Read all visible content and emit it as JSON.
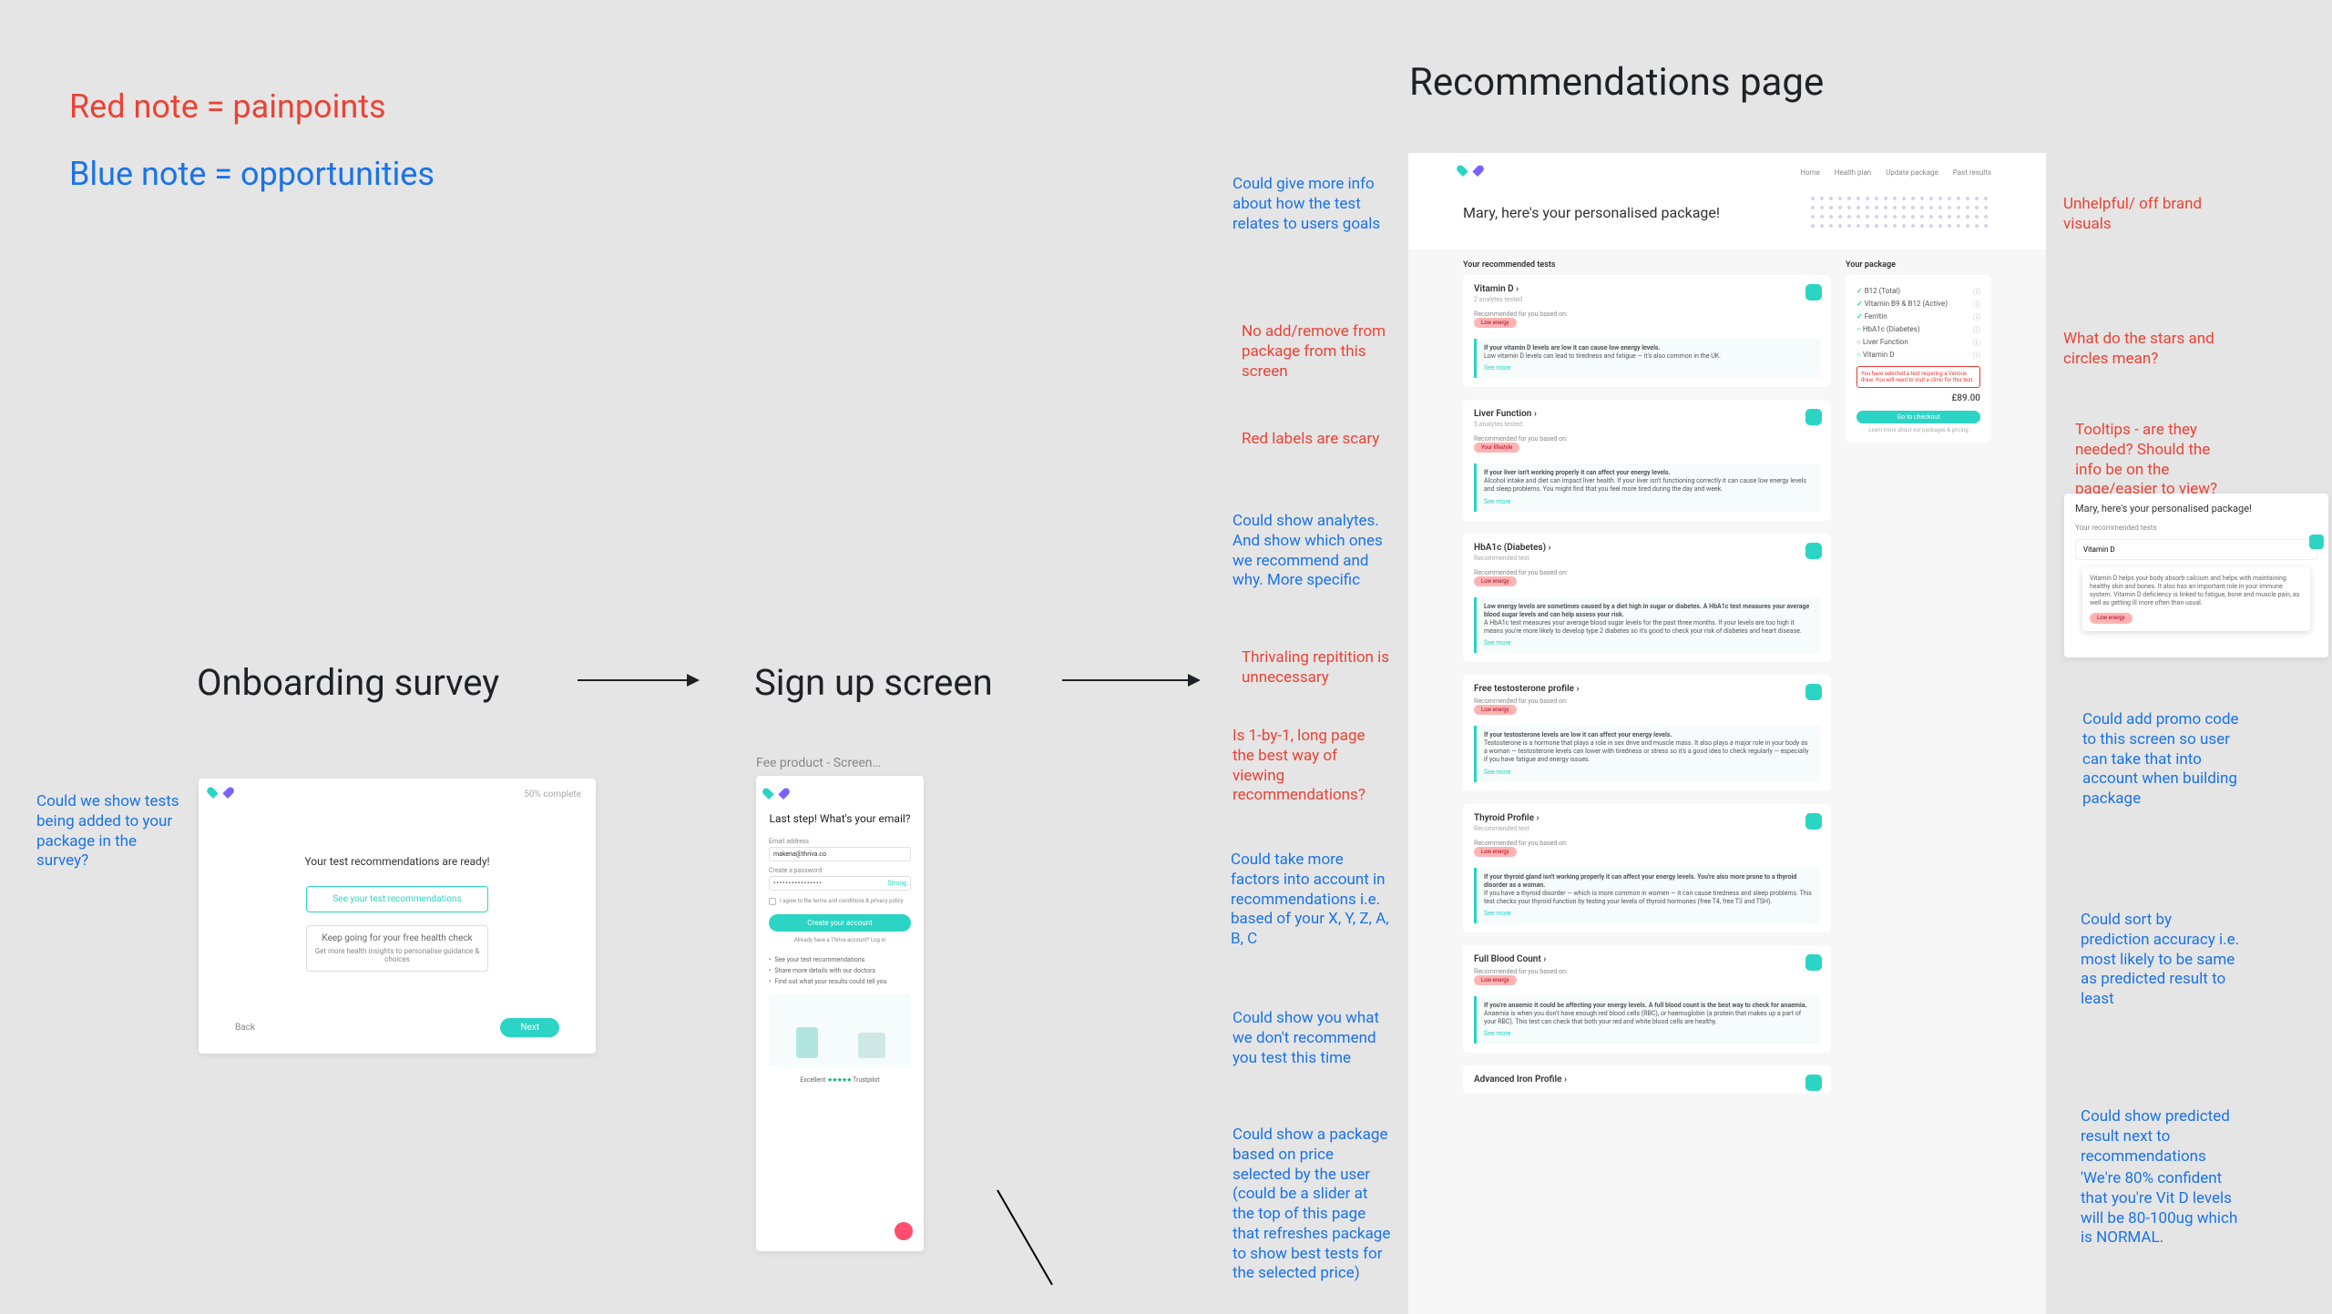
{
  "legend": {
    "red": "Red note = painpoints",
    "blue": "Blue note = opportunities"
  },
  "headings": {
    "onboarding": "Onboarding survey",
    "signup": "Sign up screen",
    "recommendations": "Recommendations page"
  },
  "notes": {
    "left1": "Could we show tests being added to your package in the survey?",
    "signup_caption": "Fee product - Screen…",
    "mid": [
      "Could give more info about how the test relates to users goals",
      "No add/remove from package from this screen",
      "Red labels are scary",
      "Could show analytes. And show which ones we recommend and why. More specific",
      "Thrivaling repitition is unnecessary",
      "Is 1-by-1, long page the best way of viewing recommendations?",
      "Could take more factors into account in recommendations i.e. based of your X, Y, Z, A, B, C",
      "Could show you what we don't recommend you test this time",
      "Could show a package based on price selected by the user (could be a slider at the top of this page that refreshes package to show best tests for the selected price)"
    ],
    "right": [
      "Unhelpful/ off brand visuals",
      "What do the stars and circles mean?",
      "Tooltips - are they needed? Should the info be on the page/easier to view?",
      "Could add promo code to this screen so user can take that into account when building package",
      "Could sort by prediction accuracy i.e. most likely to be same as predicted result to least",
      "Could show predicted result next to recommendations",
      "'We're 80% confident that you're Vit D levels will be 80-100ug which is NORMAL."
    ]
  },
  "onboard": {
    "topright": "50% complete",
    "headline": "Your test recommendations are ready!",
    "btn1": "See your test recommendations",
    "btn2": "Keep going for your free health check",
    "btn2_sub": "Get more health insights to personalise guidance & choices",
    "back": "Back",
    "next": "Next"
  },
  "signup": {
    "title": "Last step! What's your email?",
    "label_email": "Email address",
    "email_value": "makena@thriva.co",
    "label_pwd": "Create a password",
    "pwd_value": "••••••••••••••••",
    "pwd_meter": "Strong",
    "consent": "I agree to the terms and conditions & privacy policy",
    "cta": "Create your account",
    "already": "Already have a Thriva account? Log in",
    "bullets": [
      "See your test recommendations",
      "Share more details with our doctors",
      "Find out what your results could tell you"
    ],
    "trust_label": "Excellent",
    "trust_brand": "Trustpilot"
  },
  "rec": {
    "nav": [
      "Home",
      "Health plan",
      "Update package",
      "Past results"
    ],
    "hero": "Mary, here's your personalised package!",
    "col_left": "Your recommended tests",
    "col_right": "Your package",
    "package_items": [
      {
        "name": "B12 (Total)",
        "checked": true
      },
      {
        "name": "Vitamin B9 & B12 (Active)",
        "checked": true
      },
      {
        "name": "Ferritin",
        "checked": true
      },
      {
        "name": "HbA1c (Diabetes)",
        "checked": false
      },
      {
        "name": "Liver Function",
        "checked": false
      },
      {
        "name": "Vitamin D",
        "checked": false
      }
    ],
    "package_error": "You have selected a test requiring a Venous draw. You will need to visit a clinic for this test.",
    "price": "£89.00",
    "checkout": "Go to checkout",
    "checkout_sub": "Learn more about our packages & pricing",
    "tests": [
      {
        "title": "Vitamin D",
        "sub": "2 analytes tested",
        "meta": "Recommended for you based on:",
        "tag": "Low energy",
        "explain_head": "If your vitamin D levels are low it can cause low energy levels.",
        "explain_body": "Low vitamin D levels can lead to tiredness and fatigue — it's also common in the UK.",
        "more": "See more"
      },
      {
        "title": "Liver Function",
        "sub": "5 analytes tested",
        "meta": "Recommended for you based on:",
        "tag": "Your lifestyle",
        "explain_head": "If your liver isn't working properly it can affect your energy levels.",
        "explain_body": "Alcohol intake and diet can impact liver health. If your liver isn't functioning correctly it can cause low energy levels and sleep problems. You might find that you feel more tired during the day and week.",
        "more": "See more"
      },
      {
        "title": "HbA1c (Diabetes)",
        "sub": "Recommended test",
        "meta": "Recommended for you based on:",
        "tag": "Low energy",
        "explain_head": "Low energy levels are sometimes caused by a diet high in sugar or diabetes. A HbA1c test measures your average blood sugar levels and can help assess your risk.",
        "explain_body": "A HbA1c test measures your average blood sugar levels for the past three months. If your levels are too high it means you're more likely to develop type 2 diabetes so it's good to check your risk of diabetes and heart disease.",
        "more": "See more"
      },
      {
        "title": "Free testosterone profile",
        "sub": "",
        "meta": "Recommended for you based on:",
        "tag": "Low energy",
        "explain_head": "If your testosterone levels are low it can affect your energy levels.",
        "explain_body": "Testosterone is a hormone that plays a role in sex drive and muscle mass. It also plays a major role in your body as a woman — testosterone levels can lower with tiredness or stress so it's a good idea to check regularly — especially if you have fatigue and energy issues.",
        "more": "See more"
      },
      {
        "title": "Thyroid Profile",
        "sub": "Recommended test",
        "meta": "Recommended for you based on:",
        "tag": "Low energy",
        "explain_head": "If your thyroid gland isn't working properly it can affect your energy levels. You're also more prone to a thyroid disorder as a woman.",
        "explain_body": "If you have a thyroid disorder — which is more common in women — it can cause tiredness and sleep problems. This test checks your thyroid function by testing your levels of thyroid hormones (free T4, free T3 and TSH).",
        "more": "See more"
      },
      {
        "title": "Full Blood Count",
        "sub": "",
        "meta": "Recommended for you based on:",
        "tag": "Low energy",
        "explain_head": "If you're anaemic it could be affecting your energy levels. A full blood count is the best way to check for anaemia.",
        "explain_body": "Anaemia is when you don't have enough red blood cells (RBC), or haemoglobin (a protein that makes up a part of your RBC). This test can check that both your red and white blood cells are healthy.",
        "more": "See more"
      },
      {
        "title": "Advanced Iron Profile",
        "sub": "",
        "meta": "",
        "tag": "",
        "explain_head": "",
        "explain_body": "",
        "more": ""
      }
    ]
  },
  "tooltip": {
    "hero": "Mary, here's your personalised package!",
    "col": "Your recommended tests",
    "test": "Vitamin D",
    "tip_body": "Vitamin D helps your body absorb calcium and helps with maintaining healthy skin and bones. It also has an important role in your immune system. Vitamin D deficiency is linked to fatigue, bone and muscle pain, as well as getting ill more often than usual.",
    "tag": "Low energy"
  }
}
